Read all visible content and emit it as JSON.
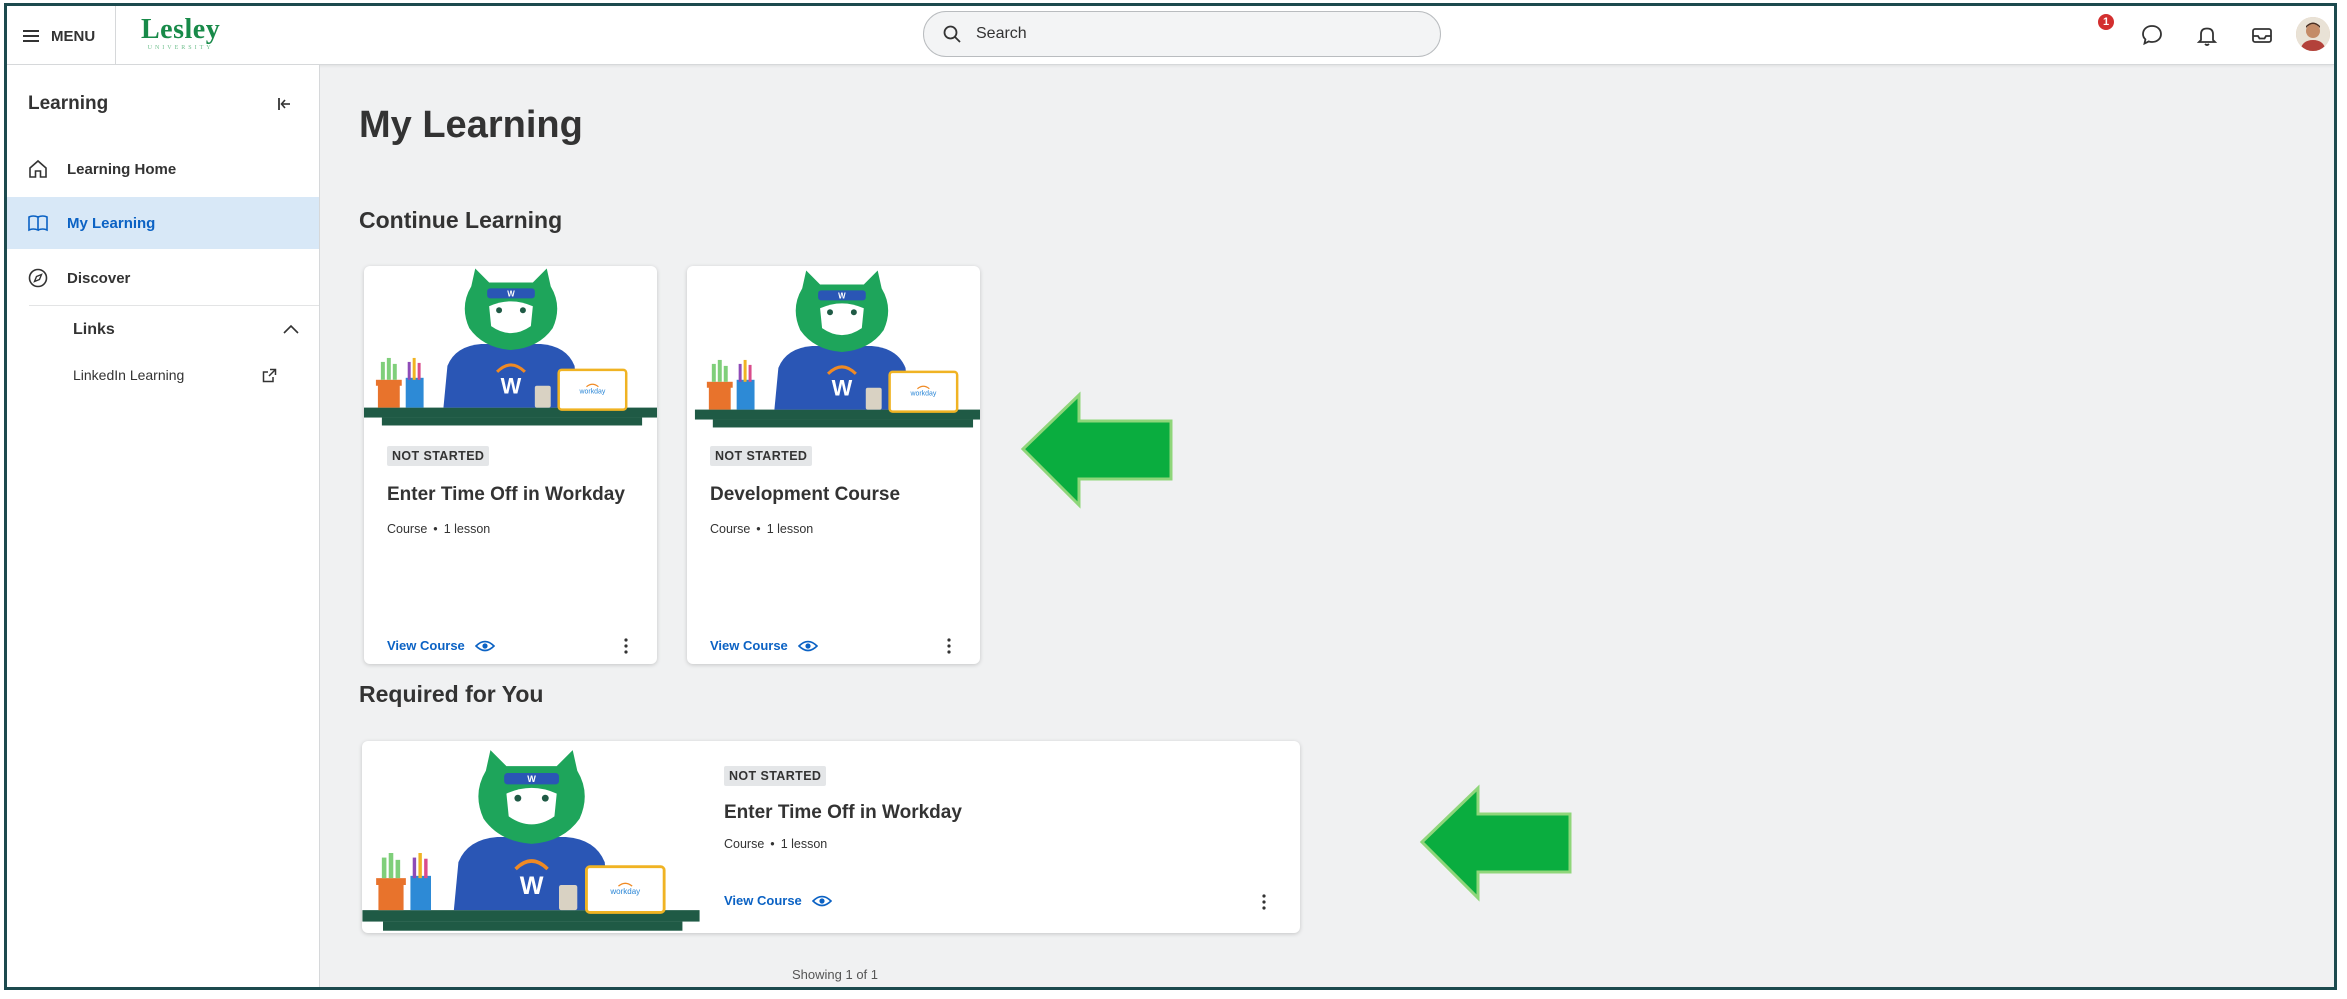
{
  "header": {
    "menu_label": "MENU",
    "logo_text": "Lesley",
    "logo_subtext": "UNIVERSITY",
    "search_placeholder": "Search",
    "notification_count": "1"
  },
  "sidebar": {
    "title": "Learning",
    "items": [
      {
        "label": "Learning Home",
        "icon": "home-icon"
      },
      {
        "label": "My Learning",
        "icon": "book-icon",
        "active": true
      },
      {
        "label": "Discover",
        "icon": "compass-icon"
      }
    ],
    "links_title": "Links",
    "links": [
      {
        "label": "LinkedIn Learning",
        "icon": "external-link-icon"
      }
    ]
  },
  "main": {
    "page_title": "My Learning",
    "continue_title": "Continue Learning",
    "continue_cards": [
      {
        "status": "NOT STARTED",
        "title": "Enter Time Off in Workday",
        "type": "Course",
        "lessons": "1 lesson",
        "action": "View Course"
      },
      {
        "status": "NOT STARTED",
        "title": "Development Course",
        "type": "Course",
        "lessons": "1 lesson",
        "action": "View Course"
      }
    ],
    "required_title": "Required for You",
    "required_cards": [
      {
        "status": "NOT STARTED",
        "title": "Enter Time Off in Workday",
        "type": "Course",
        "lessons": "1 lesson",
        "action": "View Course"
      }
    ],
    "showing_text": "Showing 1 of 1"
  },
  "colors": {
    "brand_green": "#188a49",
    "link_blue": "#0b62c4",
    "active_bg": "#d8e8f7",
    "annotation_arrow": "#0aad3f",
    "frame_border": "#1c4a4e"
  }
}
